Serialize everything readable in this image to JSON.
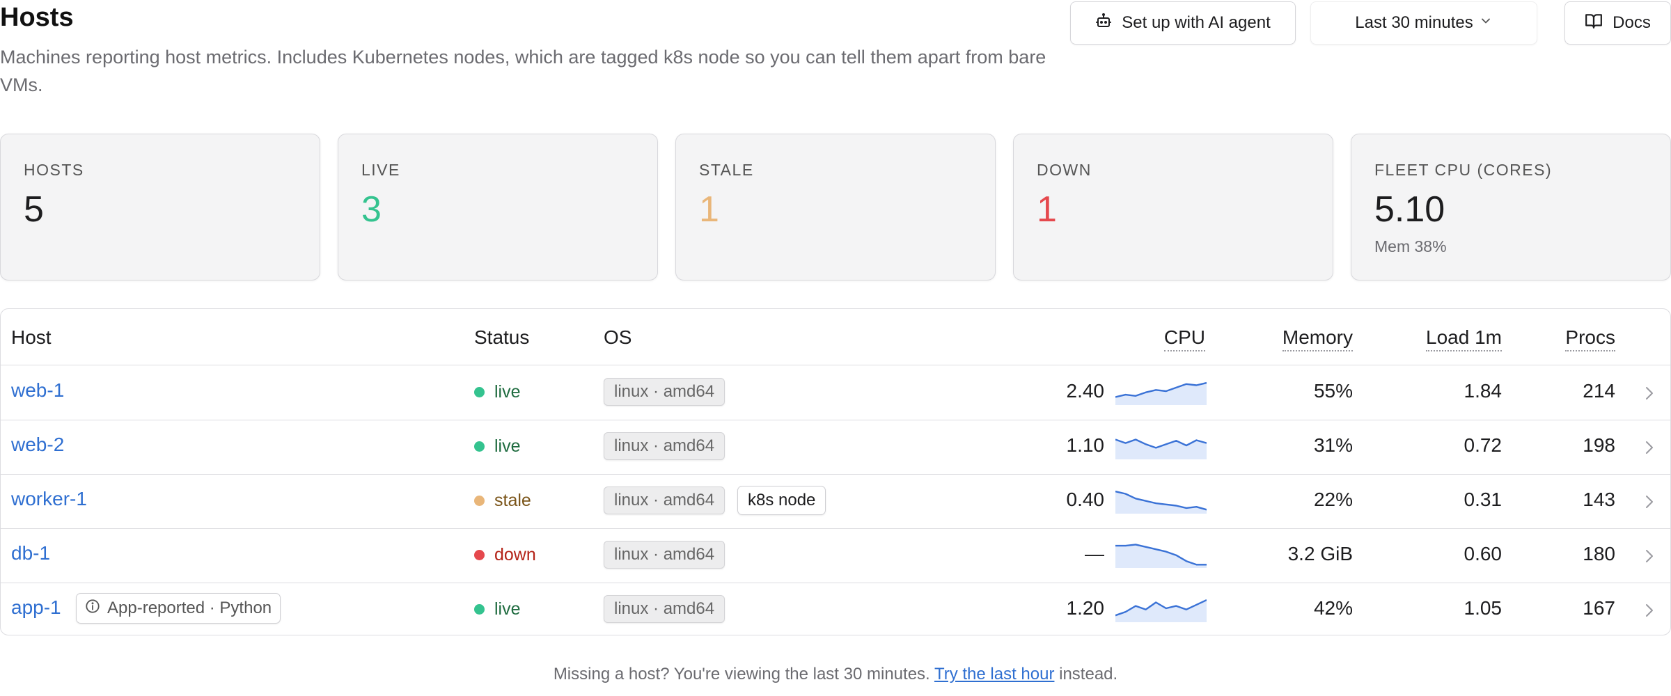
{
  "header": {
    "title": "Hosts",
    "subtitle": "Machines reporting host metrics. Includes Kubernetes nodes, which are tagged k8s node so you can tell them apart from bare VMs.",
    "ai_button": "Set up with AI agent",
    "time_range": "Last 30 minutes",
    "docs_button": "Docs"
  },
  "stats": {
    "hosts": {
      "label": "HOSTS",
      "value": "5"
    },
    "live": {
      "label": "LIVE",
      "value": "3",
      "color": "#34c38f"
    },
    "stale": {
      "label": "STALE",
      "value": "1",
      "color": "#e9b679"
    },
    "down": {
      "label": "DOWN",
      "value": "1",
      "color": "#e5484d"
    },
    "fleet_cpu": {
      "label": "FLEET CPU (CORES)",
      "value": "5.10",
      "sub": "Mem 38%"
    }
  },
  "table": {
    "columns": {
      "host": "Host",
      "status": "Status",
      "os": "OS",
      "cpu": "CPU",
      "memory": "Memory",
      "load": "Load 1m",
      "procs": "Procs"
    },
    "rows": [
      {
        "host": "web-1",
        "status": "live",
        "os": "linux · amd64",
        "cpu": "2.40",
        "cpu_trend": [
          0.25,
          0.35,
          0.3,
          0.45,
          0.55,
          0.5,
          0.65,
          0.8,
          0.75,
          0.85
        ],
        "memory": "55%",
        "load": "1.84",
        "procs": "214"
      },
      {
        "host": "web-2",
        "status": "live",
        "os": "linux · amd64",
        "cpu": "1.10",
        "cpu_trend": [
          0.75,
          0.6,
          0.75,
          0.55,
          0.4,
          0.55,
          0.7,
          0.5,
          0.72,
          0.6
        ],
        "memory": "31%",
        "load": "0.72",
        "procs": "198"
      },
      {
        "host": "worker-1",
        "status": "stale",
        "tag": "k8s node",
        "os": "linux · amd64",
        "cpu": "0.40",
        "cpu_trend": [
          0.85,
          0.75,
          0.55,
          0.45,
          0.35,
          0.3,
          0.25,
          0.15,
          0.2,
          0.08
        ],
        "memory": "22%",
        "load": "0.31",
        "procs": "143"
      },
      {
        "host": "db-1",
        "status": "down",
        "os": "linux · amd64",
        "cpu": "—",
        "cpu_trend": [
          0.85,
          0.85,
          0.9,
          0.8,
          0.7,
          0.6,
          0.45,
          0.2,
          0.05,
          0.05
        ],
        "memory": "3.2 GiB",
        "load": "0.60",
        "procs": "180"
      },
      {
        "host": "app-1",
        "status": "live",
        "badge": "App-reported · Python",
        "os": "linux · amd64",
        "cpu": "1.20",
        "cpu_trend": [
          0.2,
          0.35,
          0.6,
          0.45,
          0.75,
          0.5,
          0.6,
          0.45,
          0.65,
          0.85
        ],
        "memory": "42%",
        "load": "1.05",
        "procs": "167"
      }
    ]
  },
  "footer": {
    "prefix": "Missing a host? You're viewing the last 30 minutes.",
    "link": "Try the last hour",
    "suffix": "instead."
  },
  "colors": {
    "accent": "#2f6fd1",
    "live": "#34c38f",
    "stale": "#e9b679",
    "down": "#e5484d",
    "live_text": "#1e6b3f",
    "stale_text": "#7a5418",
    "down_text": "#b42318",
    "sparkline": "#3a72d6"
  }
}
